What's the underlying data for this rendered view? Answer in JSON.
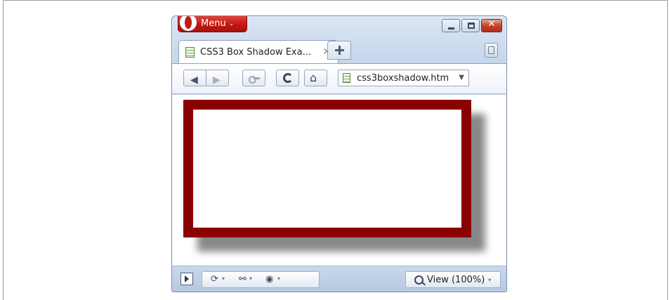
{
  "app": {
    "menu_label": "Menu",
    "menu_caret": "⌄"
  },
  "window_controls": {
    "close_glyph": "✕"
  },
  "tabs": [
    {
      "title": "CSS3 Box Shadow Exa...",
      "close_glyph": "✕",
      "active": true
    }
  ],
  "toolbar": {
    "back_glyph": "◀",
    "forward_glyph": "▶",
    "home_glyph": "⌂",
    "address": "css3boxshadow.htm",
    "address_dropdown": "▼"
  },
  "content": {
    "box_border_color": "#8b0000",
    "box_shadow_color": "#888888"
  },
  "statusbar": {
    "icons": [
      "sync-icon",
      "share-icon",
      "speed-dial-icon"
    ],
    "caret": "▾",
    "zoom_label": "View (100%)",
    "zoom_caret": "▾"
  }
}
